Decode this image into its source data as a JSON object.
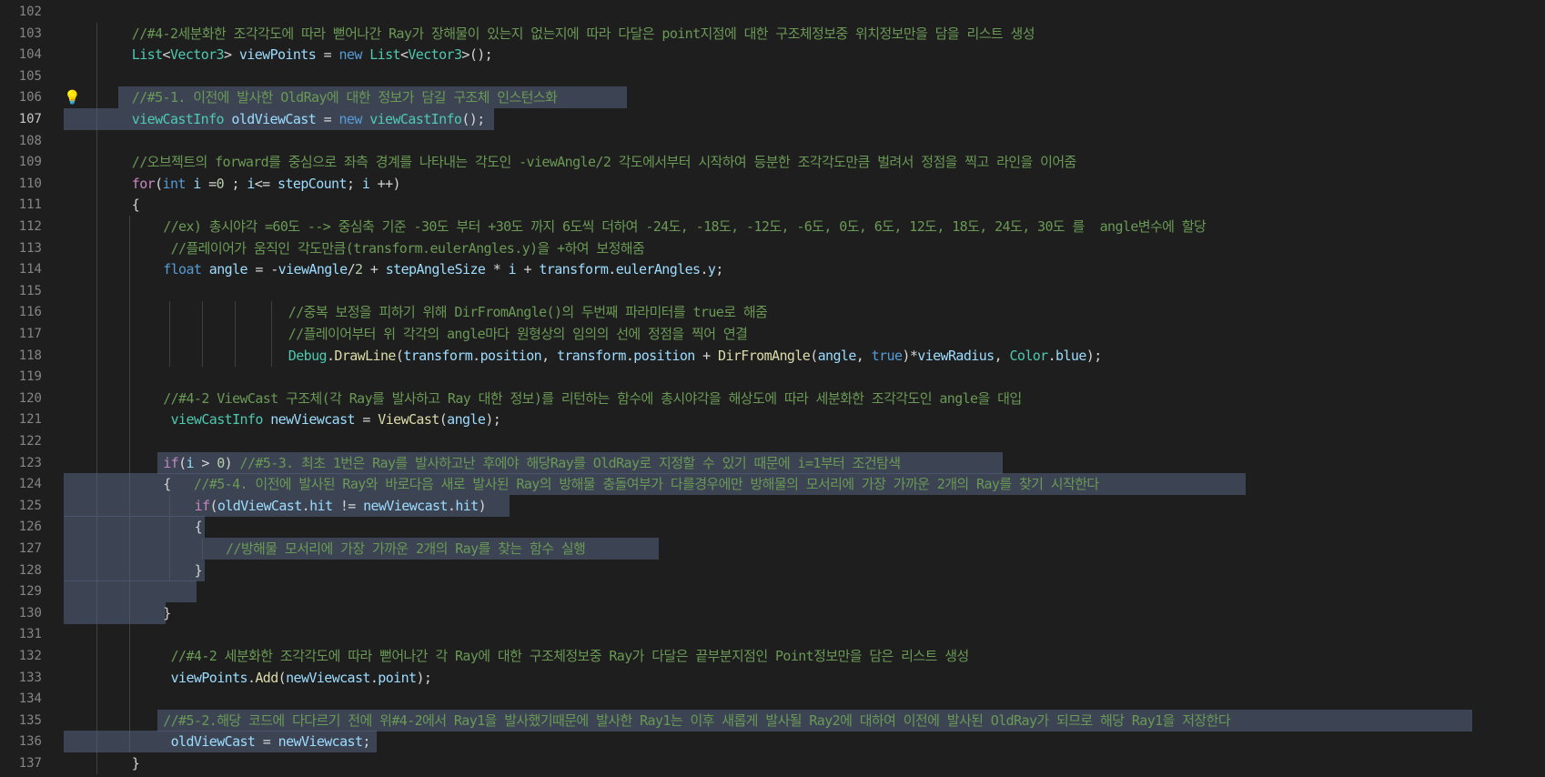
{
  "editor": {
    "lines": [
      {
        "num": "102",
        "tokens": []
      },
      {
        "num": "103",
        "tokens": [
          {
            "t": "//#4-2세분화한 조각각도에 따라 뻗어나간 Ray가 장해물이 있는지 없는지에 따라 다달은 point지점에 대한 구조체정보중 위치정보만을 담을 리스트 생성",
            "c": "cm"
          }
        ]
      },
      {
        "num": "104",
        "tokens": [
          {
            "t": "List",
            "c": "ty"
          },
          {
            "t": "<",
            "c": "pl"
          },
          {
            "t": "Vector3",
            "c": "ty"
          },
          {
            "t": "> ",
            "c": "pl"
          },
          {
            "t": "viewPoints",
            "c": "id"
          },
          {
            "t": " = ",
            "c": "pl"
          },
          {
            "t": "new",
            "c": "kw"
          },
          {
            "t": " ",
            "c": "pl"
          },
          {
            "t": "List",
            "c": "ty"
          },
          {
            "t": "<",
            "c": "pl"
          },
          {
            "t": "Vector3",
            "c": "ty"
          },
          {
            "t": ">();",
            "c": "pl"
          }
        ]
      },
      {
        "num": "105",
        "tokens": []
      },
      {
        "num": "106",
        "tokens": [
          {
            "t": "//#5-1. 이전에 발사한 OldRay에 대한 정보가 담길 구조체 인스턴스화",
            "c": "cm"
          }
        ]
      },
      {
        "num": "107",
        "tokens": [
          {
            "t": "viewCastInfo",
            "c": "ty"
          },
          {
            "t": " ",
            "c": "pl"
          },
          {
            "t": "oldViewCast",
            "c": "id"
          },
          {
            "t": " = ",
            "c": "pl"
          },
          {
            "t": "new",
            "c": "kw"
          },
          {
            "t": " ",
            "c": "pl"
          },
          {
            "t": "viewCastInfo",
            "c": "ty"
          },
          {
            "t": "();",
            "c": "pl"
          }
        ]
      },
      {
        "num": "108",
        "tokens": []
      },
      {
        "num": "109",
        "tokens": [
          {
            "t": "//오브젝트의 forward를 중심으로 좌측 경계를 나타내는 각도인 -viewAngle/2 각도에서부터 시작하여 등분한 조각각도만큼 벌려서 정점을 찍고 라인을 이어줌",
            "c": "cm"
          }
        ]
      },
      {
        "num": "110",
        "tokens": [
          {
            "t": "for",
            "c": "ctl"
          },
          {
            "t": "(",
            "c": "pl"
          },
          {
            "t": "int",
            "c": "kw"
          },
          {
            "t": " ",
            "c": "pl"
          },
          {
            "t": "i",
            "c": "id"
          },
          {
            "t": " =",
            "c": "pl"
          },
          {
            "t": "0",
            "c": "nm"
          },
          {
            "t": " ; ",
            "c": "pl"
          },
          {
            "t": "i",
            "c": "id"
          },
          {
            "t": "<= ",
            "c": "pl"
          },
          {
            "t": "stepCount",
            "c": "id"
          },
          {
            "t": "; ",
            "c": "pl"
          },
          {
            "t": "i",
            "c": "id"
          },
          {
            "t": " ++)",
            "c": "pl"
          }
        ]
      },
      {
        "num": "111",
        "tokens": [
          {
            "t": "{",
            "c": "pl"
          }
        ]
      },
      {
        "num": "112",
        "tokens": [
          {
            "t": "//ex) 총시야각 =60도 --> 중심축 기준 -30도 부터 +30도 까지 6도씩 더하여 -24도, -18도, -12도, -6도, 0도, 6도, 12도, 18도, 24도, 30도 를  angle변수에 할당",
            "c": "cm"
          }
        ]
      },
      {
        "num": "113",
        "tokens": [
          {
            "t": " //플레이어가 움직인 각도만큼(transform.eulerAngles.y)을 +하여 보정해줌",
            "c": "cm"
          }
        ]
      },
      {
        "num": "114",
        "tokens": [
          {
            "t": "float",
            "c": "kw"
          },
          {
            "t": " ",
            "c": "pl"
          },
          {
            "t": "angle",
            "c": "id"
          },
          {
            "t": " = -",
            "c": "pl"
          },
          {
            "t": "viewAngle",
            "c": "id"
          },
          {
            "t": "/",
            "c": "pl"
          },
          {
            "t": "2",
            "c": "nm"
          },
          {
            "t": " + ",
            "c": "pl"
          },
          {
            "t": "stepAngleSize",
            "c": "id"
          },
          {
            "t": " * ",
            "c": "pl"
          },
          {
            "t": "i",
            "c": "id"
          },
          {
            "t": " + ",
            "c": "pl"
          },
          {
            "t": "transform",
            "c": "id"
          },
          {
            "t": ".",
            "c": "pl"
          },
          {
            "t": "eulerAngles",
            "c": "id"
          },
          {
            "t": ".",
            "c": "pl"
          },
          {
            "t": "y",
            "c": "id"
          },
          {
            "t": ";",
            "c": "pl"
          }
        ]
      },
      {
        "num": "115",
        "tokens": []
      },
      {
        "num": "116",
        "tokens": [
          {
            "t": "//중복 보정을 피하기 위해 DirFromAngle()의 두번째 파라미터를 true로 해줌",
            "c": "cm"
          }
        ]
      },
      {
        "num": "117",
        "tokens": [
          {
            "t": "//플레이어부터 위 각각의 angle마다 원형상의 임의의 선에 정점을 찍어 연결",
            "c": "cm"
          }
        ]
      },
      {
        "num": "118",
        "tokens": [
          {
            "t": "Debug",
            "c": "ty"
          },
          {
            "t": ".",
            "c": "pl"
          },
          {
            "t": "DrawLine",
            "c": "fn"
          },
          {
            "t": "(",
            "c": "pl"
          },
          {
            "t": "transform",
            "c": "id"
          },
          {
            "t": ".",
            "c": "pl"
          },
          {
            "t": "position",
            "c": "id"
          },
          {
            "t": ", ",
            "c": "pl"
          },
          {
            "t": "transform",
            "c": "id"
          },
          {
            "t": ".",
            "c": "pl"
          },
          {
            "t": "position",
            "c": "id"
          },
          {
            "t": " + ",
            "c": "pl"
          },
          {
            "t": "DirFromAngle",
            "c": "fn"
          },
          {
            "t": "(",
            "c": "pl"
          },
          {
            "t": "angle",
            "c": "id"
          },
          {
            "t": ", ",
            "c": "pl"
          },
          {
            "t": "true",
            "c": "kw"
          },
          {
            "t": ")*",
            "c": "pl"
          },
          {
            "t": "viewRadius",
            "c": "id"
          },
          {
            "t": ", ",
            "c": "pl"
          },
          {
            "t": "Color",
            "c": "ty"
          },
          {
            "t": ".",
            "c": "pl"
          },
          {
            "t": "blue",
            "c": "id"
          },
          {
            "t": ");",
            "c": "pl"
          }
        ]
      },
      {
        "num": "119",
        "tokens": []
      },
      {
        "num": "120",
        "tokens": [
          {
            "t": "//#4-2 ViewCast 구조체(각 Ray를 발사하고 Ray 대한 정보)를 리턴하는 함수에 총시야각을 해상도에 따라 세분화한 조각각도인 angle을 대입",
            "c": "cm"
          }
        ]
      },
      {
        "num": "121",
        "tokens": [
          {
            "t": " ",
            "c": "pl"
          },
          {
            "t": "viewCastInfo",
            "c": "ty"
          },
          {
            "t": " ",
            "c": "pl"
          },
          {
            "t": "newViewcast",
            "c": "id"
          },
          {
            "t": " = ",
            "c": "pl"
          },
          {
            "t": "ViewCast",
            "c": "fn"
          },
          {
            "t": "(",
            "c": "pl"
          },
          {
            "t": "angle",
            "c": "id"
          },
          {
            "t": ");",
            "c": "pl"
          }
        ]
      },
      {
        "num": "122",
        "tokens": []
      },
      {
        "num": "123",
        "tokens": [
          {
            "t": "if",
            "c": "ctl"
          },
          {
            "t": "(",
            "c": "pl"
          },
          {
            "t": "i",
            "c": "id"
          },
          {
            "t": " > ",
            "c": "pl"
          },
          {
            "t": "0",
            "c": "nm"
          },
          {
            "t": ") ",
            "c": "pl"
          },
          {
            "t": "//#5-3. 최초 1번은 Ray를 발사하고난 후에야 해당Ray를 OldRay로 지정할 수 있기 때문에 i=1부터 조건탐색",
            "c": "cm"
          }
        ]
      },
      {
        "num": "124",
        "tokens": [
          {
            "t": "{   ",
            "c": "pl"
          },
          {
            "t": "//#5-4. 이전에 발사된 Ray와 바로다음 새로 발사된 Ray의 방해물 충돌여부가 다를경우에만 방해물의 모서리에 가장 가까운 2개의 Ray를 찾기 시작한다",
            "c": "cm"
          }
        ]
      },
      {
        "num": "125",
        "tokens": [
          {
            "t": "if",
            "c": "ctl"
          },
          {
            "t": "(",
            "c": "pl"
          },
          {
            "t": "oldViewCast",
            "c": "id"
          },
          {
            "t": ".",
            "c": "pl"
          },
          {
            "t": "hit",
            "c": "id"
          },
          {
            "t": " != ",
            "c": "pl"
          },
          {
            "t": "newViewcast",
            "c": "id"
          },
          {
            "t": ".",
            "c": "pl"
          },
          {
            "t": "hit",
            "c": "id"
          },
          {
            "t": ")",
            "c": "pl"
          }
        ]
      },
      {
        "num": "126",
        "tokens": [
          {
            "t": "{",
            "c": "pl"
          }
        ]
      },
      {
        "num": "127",
        "tokens": [
          {
            "t": "//방해물 모서리에 가장 가까운 2개의 Ray를 찾는 함수 실행",
            "c": "cm"
          }
        ]
      },
      {
        "num": "128",
        "tokens": [
          {
            "t": "}",
            "c": "pl"
          }
        ]
      },
      {
        "num": "129",
        "tokens": []
      },
      {
        "num": "130",
        "tokens": [
          {
            "t": "}",
            "c": "pl"
          }
        ]
      },
      {
        "num": "131",
        "tokens": []
      },
      {
        "num": "132",
        "tokens": [
          {
            "t": " //#4-2 세분화한 조각각도에 따라 뻗어나간 각 Ray에 대한 구조체정보중 Ray가 다달은 끝부분지점인 Point정보만을 담은 리스트 생성",
            "c": "cm"
          }
        ]
      },
      {
        "num": "133",
        "tokens": [
          {
            "t": " ",
            "c": "pl"
          },
          {
            "t": "viewPoints",
            "c": "id"
          },
          {
            "t": ".",
            "c": "pl"
          },
          {
            "t": "Add",
            "c": "fn"
          },
          {
            "t": "(",
            "c": "pl"
          },
          {
            "t": "newViewcast",
            "c": "id"
          },
          {
            "t": ".",
            "c": "pl"
          },
          {
            "t": "point",
            "c": "id"
          },
          {
            "t": ");",
            "c": "pl"
          }
        ]
      },
      {
        "num": "134",
        "tokens": []
      },
      {
        "num": "135",
        "tokens": [
          {
            "t": "//#5-2.해당 코드에 다다르기 전에 위#4-2에서 Ray1을 발사했기때문에 발사한 Ray1는 이후 새롭게 발사될 Ray2에 대하여 이전에 발사된 OldRay가 되므로 해당 Ray1을 저장한다",
            "c": "cm"
          }
        ]
      },
      {
        "num": "136",
        "tokens": [
          {
            "t": " ",
            "c": "pl"
          },
          {
            "t": "oldViewCast",
            "c": "id"
          },
          {
            "t": " = ",
            "c": "pl"
          },
          {
            "t": "newViewcast",
            "c": "id"
          },
          {
            "t": ";",
            "c": "pl"
          }
        ]
      },
      {
        "num": "137",
        "tokens": [
          {
            "t": "}",
            "c": "pl"
          }
        ]
      }
    ]
  }
}
